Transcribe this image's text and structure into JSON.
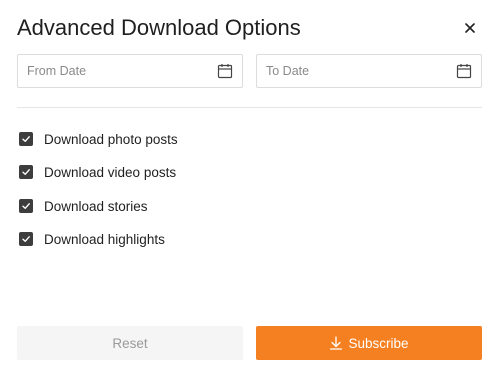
{
  "dialog": {
    "title": "Advanced Download Options",
    "close_icon": "close-icon"
  },
  "dates": {
    "from": {
      "placeholder": "From Date",
      "value": "",
      "icon": "calendar-icon"
    },
    "to": {
      "placeholder": "To Date",
      "value": "",
      "icon": "calendar-icon"
    }
  },
  "options": [
    {
      "label": "Download photo posts",
      "checked": true
    },
    {
      "label": "Download video posts",
      "checked": true
    },
    {
      "label": "Download stories",
      "checked": true
    },
    {
      "label": "Download highlights",
      "checked": true
    }
  ],
  "buttons": {
    "reset_label": "Reset",
    "subscribe_label": "Subscribe",
    "subscribe_icon": "download-icon"
  },
  "colors": {
    "accent": "#f58021",
    "checkbox": "#3d3d3d",
    "reset_bg": "#f5f5f5"
  }
}
